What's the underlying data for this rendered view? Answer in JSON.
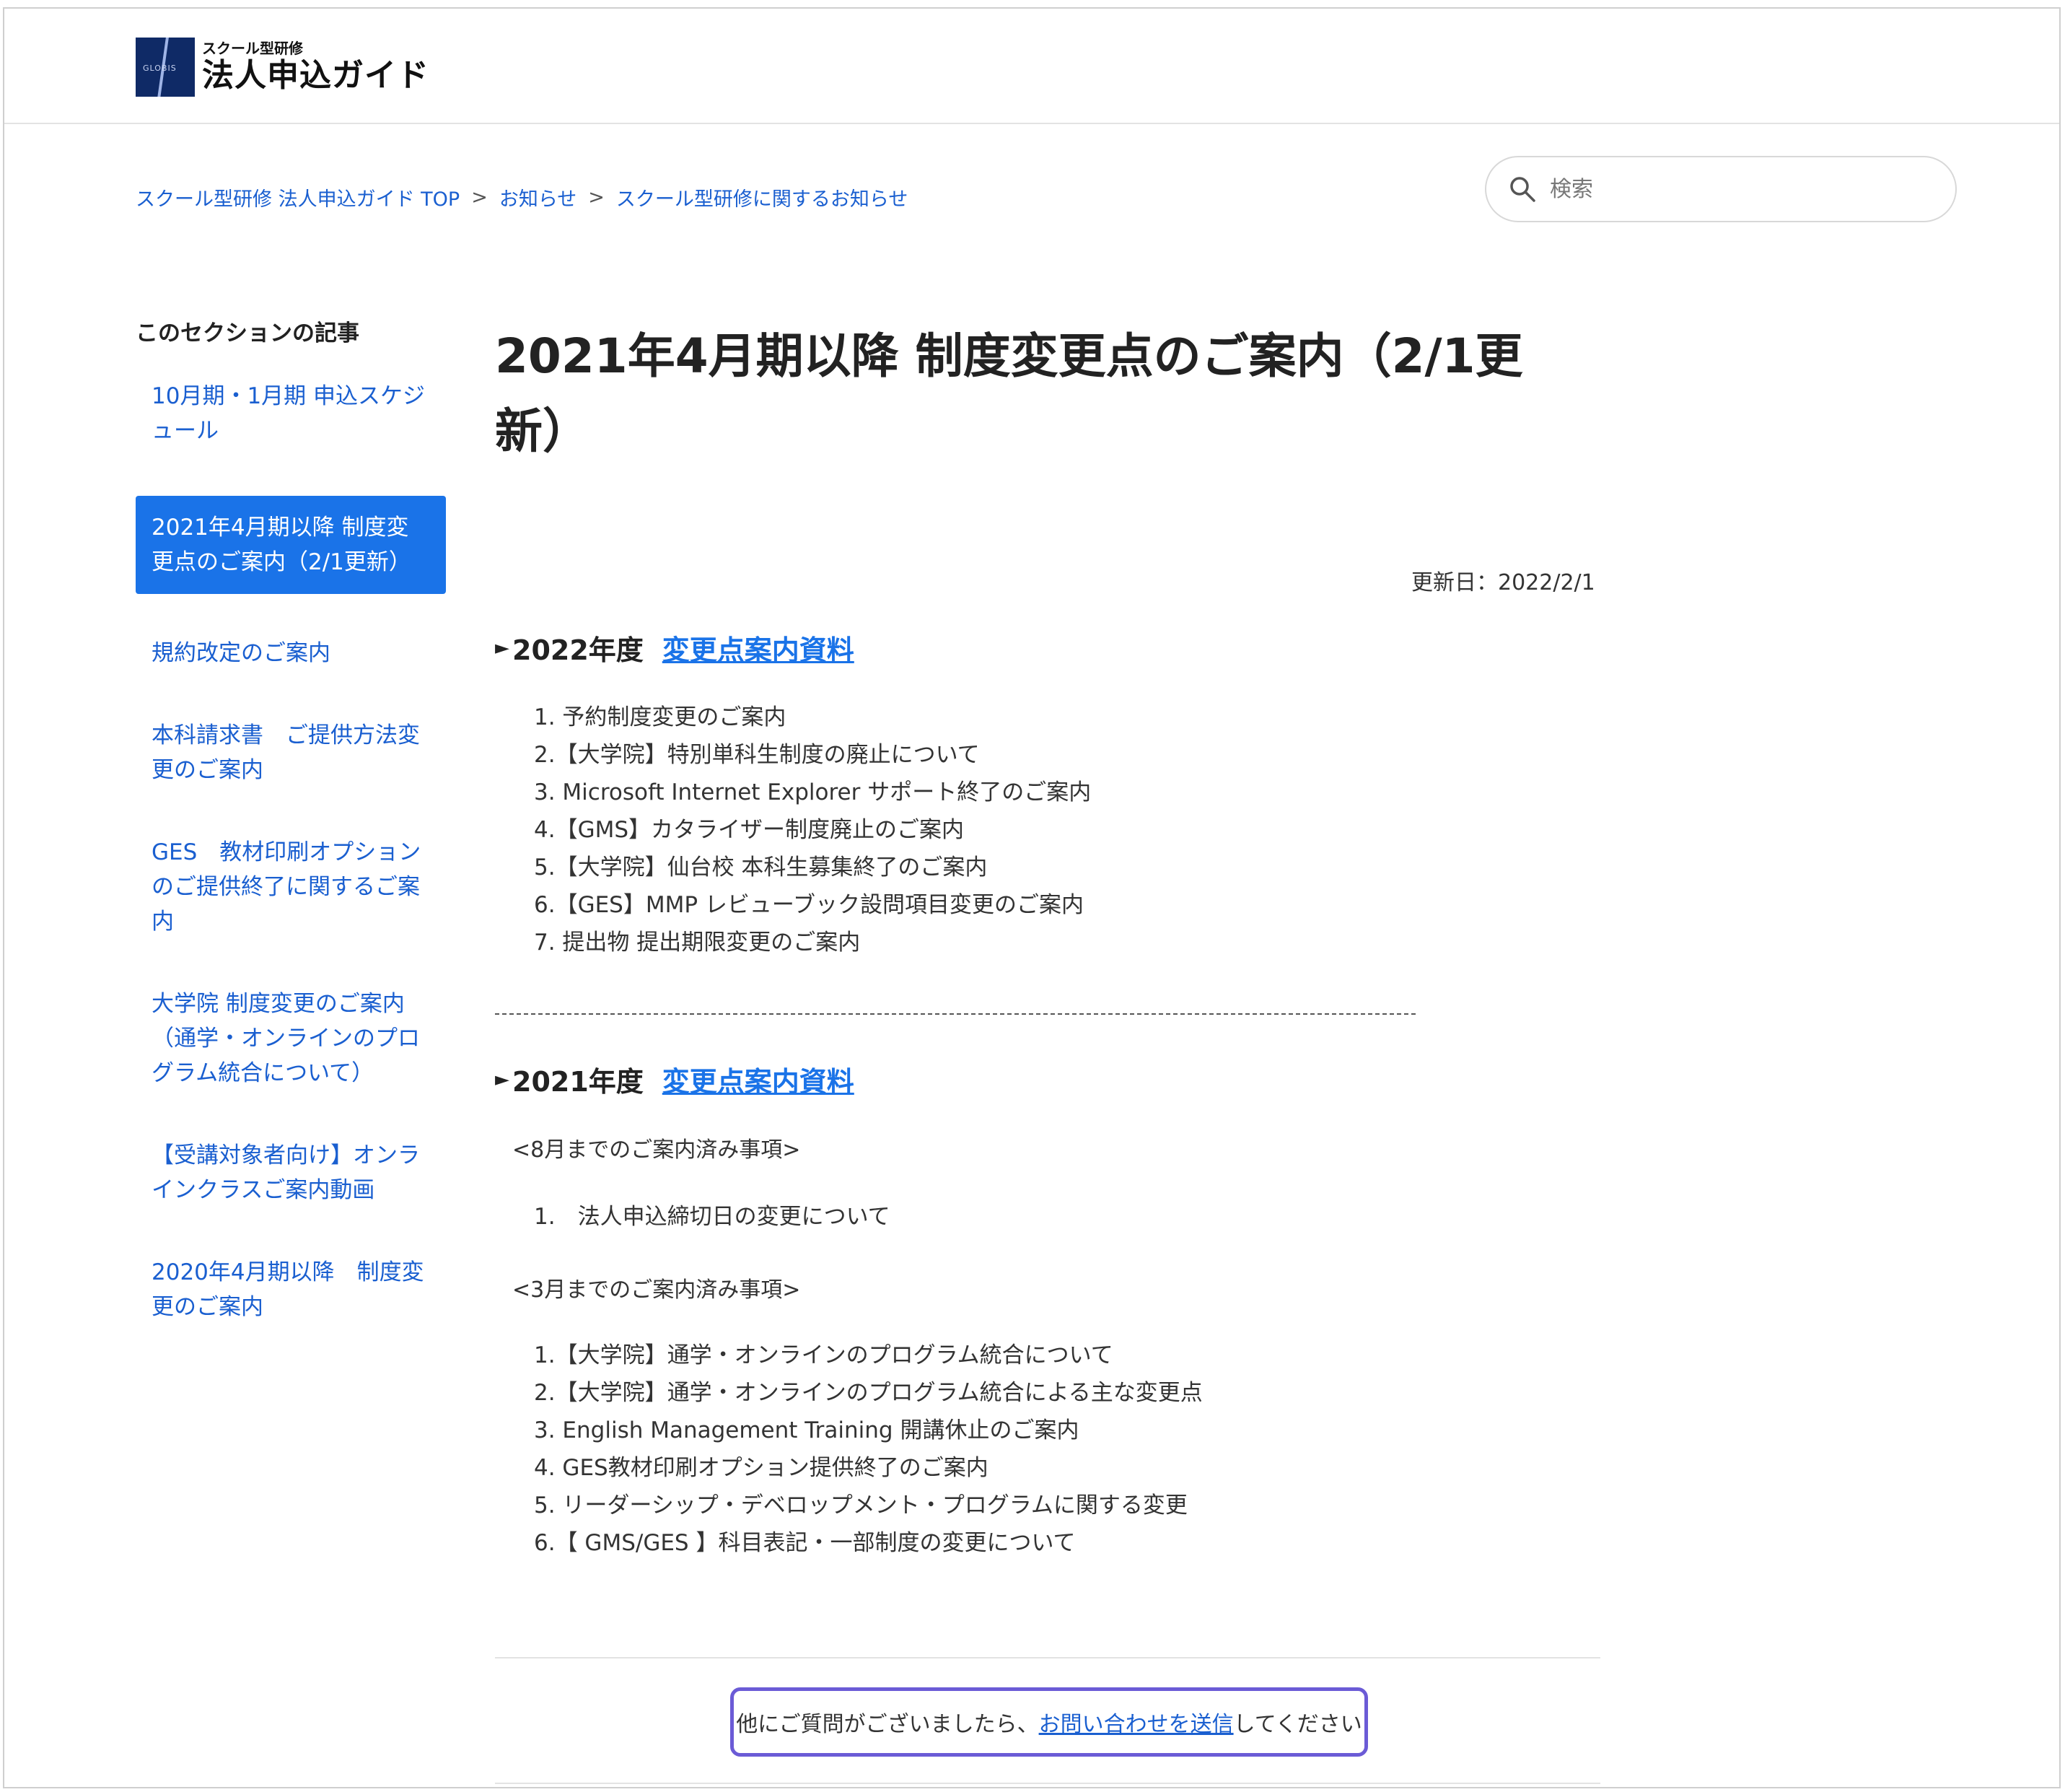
{
  "header": {
    "logo_sub": "スクール型研修",
    "logo_main": "法人申込ガイド",
    "logo_mark_text": "GLOBIS"
  },
  "breadcrumb": {
    "items": [
      "スクール型研修 法人申込ガイド TOP",
      "お知らせ",
      "スクール型研修に関するお知らせ"
    ],
    "separator": ">"
  },
  "search": {
    "placeholder": "検索",
    "icon": "search-icon"
  },
  "sidebar": {
    "title": "このセクションの記事",
    "items": [
      {
        "label": "10月期・1月期 申込スケジュール",
        "active": false
      },
      {
        "label": "2021年4月期以降 制度変更点のご案内（2/1更新）",
        "active": true
      },
      {
        "label": "規約改定のご案内",
        "active": false
      },
      {
        "label": "本科請求書　ご提供方法変更のご案内",
        "active": false
      },
      {
        "label": "GES　教材印刷オプションのご提供終了に関するご案内",
        "active": false
      },
      {
        "label": "大学院 制度変更のご案内（通学・オンラインのプログラム統合について）",
        "active": false
      },
      {
        "label": "【受講対象者向け】オンラインクラスご案内動画",
        "active": false
      },
      {
        "label": "2020年4月期以降　制度変更のご案内",
        "active": false
      }
    ]
  },
  "article": {
    "title": "2021年4月期以降 制度変更点のご案内（2/1更新）",
    "updated": "更新日：2022/2/1",
    "section_2022": {
      "heading": "2022年度",
      "link": "変更点案内資料",
      "items": [
        "1. 予約制度変更のご案内",
        "2.【大学院】特別単科生制度の廃止について",
        "3. Microsoft Internet Explorer サポート終了のご案内",
        "4.【GMS】カタライザー制度廃止のご案内",
        "5.【大学院】仙台校 本科生募集終了のご案内",
        "6.【GES】MMP レビューブック設問項目変更のご案内",
        "7. 提出物 提出期限変更のご案内"
      ]
    },
    "section_2021": {
      "heading": "2021年度",
      "link": "変更点案内資料",
      "note_aug": "<8月までのご案内済み事項>",
      "items_aug": [
        "1.　法人申込締切日の変更について"
      ],
      "note_mar": "<3月までのご案内済み事項>",
      "items_mar": [
        "1.【大学院】通学・オンラインのプログラム統合について",
        "2.【大学院】通学・オンラインのプログラム統合による主な変更点",
        "3. English Management Training 開講休止のご案内",
        "4. GES教材印刷オプション提供終了のご案内",
        "5. リーダーシップ・デベロップメント・プログラムに関する変更",
        "6.【 GMS/GES 】科目表記・一部制度の変更について"
      ]
    }
  },
  "contact": {
    "prefix": "他にご質問がございましたら、",
    "link": "お問い合わせを送信",
    "suffix": "してください"
  },
  "colors": {
    "link": "#1a5fd0",
    "active_bg": "#1a73e8",
    "highlight_border": "#6b5bd6"
  }
}
